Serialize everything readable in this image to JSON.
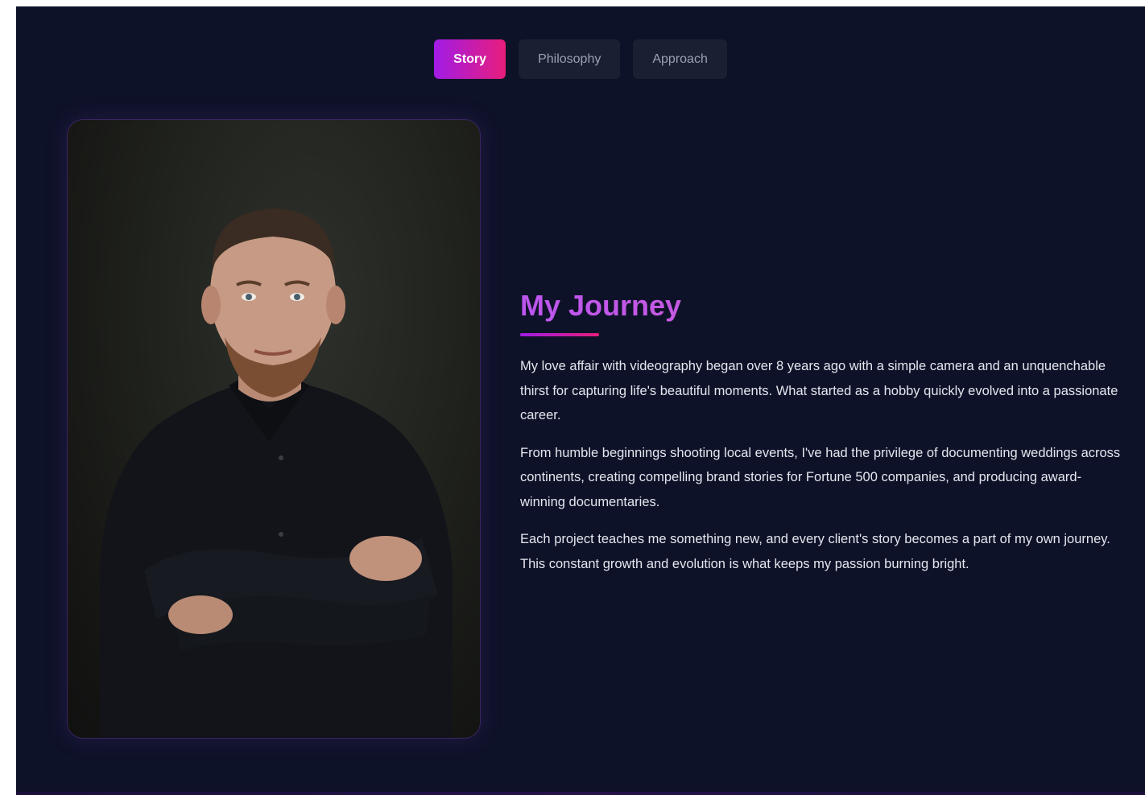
{
  "tabs": [
    {
      "label": "Story",
      "active": true
    },
    {
      "label": "Philosophy",
      "active": false
    },
    {
      "label": "Approach",
      "active": false
    }
  ],
  "story": {
    "heading": "My Journey",
    "paragraphs": [
      "My love affair with videography began over 8 years ago with a simple camera and an unquenchable thirst for capturing life's beautiful moments. What started as a hobby quickly evolved into a passionate career.",
      "From humble beginnings shooting local events, I've had the privilege of documenting weddings across continents, creating compelling brand stories for Fortune 500 companies, and producing award-winning documentaries.",
      "Each project teaches me something new, and every client's story becomes a part of my own journey. This constant growth and evolution is what keeps my passion burning bright."
    ]
  },
  "colors": {
    "background": "#0e1228",
    "accent_start": "#a11ce6",
    "accent_end": "#e81d7c",
    "tab_inactive": "#1a2032",
    "text": "#e4e6ee"
  }
}
